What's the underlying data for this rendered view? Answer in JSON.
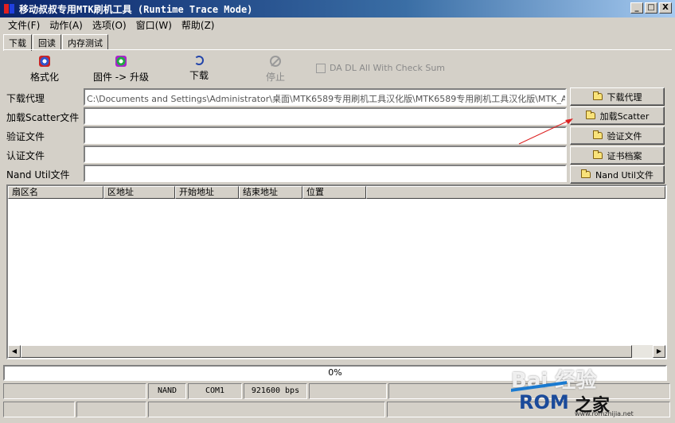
{
  "window": {
    "title": "移动叔叔专用MTK刷机工具 (Runtime Trace Mode)",
    "buttons": [
      "_",
      "□",
      "X"
    ]
  },
  "menu": [
    "文件(F)",
    "动作(A)",
    "选项(O)",
    "窗口(W)",
    "帮助(Z)"
  ],
  "tabs": [
    "下载",
    "回读",
    "内存测试"
  ],
  "toolbar": {
    "format": "格式化",
    "firmware_upgrade": "固件 -> 升级",
    "download": "下载",
    "stop": "停止",
    "checksum_label": "DA DL All With Check Sum"
  },
  "files": [
    {
      "label": "下载代理",
      "value": "C:\\Documents and Settings\\Administrator\\桌面\\MTK6589专用刷机工具汉化版\\MTK6589专用刷机工具汉化版\\MTK_AllInOne",
      "button": "下载代理"
    },
    {
      "label": "加载Scatter文件",
      "value": "",
      "button": "加载Scatter"
    },
    {
      "label": "验证文件",
      "value": "",
      "button": "验证文件"
    },
    {
      "label": "认证文件",
      "value": "",
      "button": "证书档案"
    },
    {
      "label": "Nand Util文件",
      "value": "",
      "button": "Nand Util文件"
    }
  ],
  "list_columns": [
    "扇区名",
    "区地址",
    "开始地址",
    "结束地址",
    "位置"
  ],
  "progress": {
    "text": "0%",
    "value": 0
  },
  "status": {
    "storage": "NAND",
    "port": "COM1",
    "baud": "921600 bps"
  },
  "watermark": {
    "baidu": "Bai 经验",
    "rom": "ROM",
    "zhijia": "之家",
    "url": "www.romzhijia.net"
  },
  "colors": {
    "title_start": "#0a246a",
    "title_end": "#a6caf0",
    "face": "#d4d0c8",
    "annotation_arrow": "#dd2222"
  }
}
